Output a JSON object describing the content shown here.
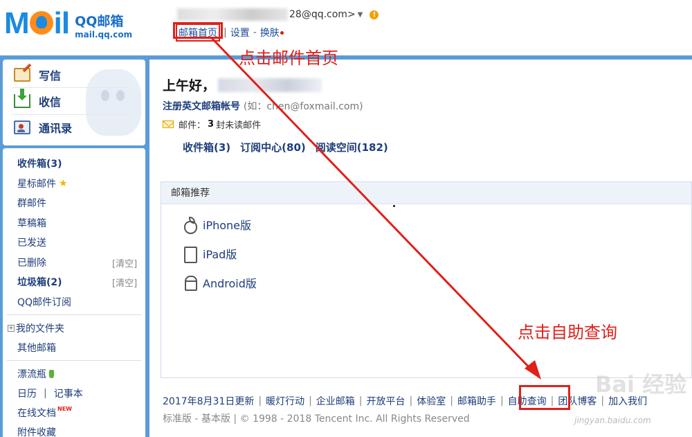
{
  "header": {
    "logo_mark": "M",
    "logo_mark_tail": "il",
    "brand_cn": "QQ邮箱",
    "brand_url": "mail.qq.com",
    "account_suffix": "28@qq.com>",
    "links": [
      "邮箱首页",
      "设置",
      "换肤"
    ],
    "link_dash": "-",
    "link_pipe": "|"
  },
  "sidebar": {
    "actions": [
      {
        "label": "写信",
        "icon": "write-icon"
      },
      {
        "label": "收信",
        "icon": "inbox-download-icon"
      },
      {
        "label": "通讯录",
        "icon": "contacts-icon"
      }
    ],
    "folders": [
      {
        "label": "收件箱(3)",
        "bold": true
      },
      {
        "label": "星标邮件",
        "icon": "star-icon"
      },
      {
        "label": "群邮件"
      },
      {
        "label": "草稿箱"
      },
      {
        "label": "已发送"
      },
      {
        "label": "已删除",
        "action": "[清空]"
      },
      {
        "label": "垃圾箱(2)",
        "bold": true,
        "action": "[清空]"
      },
      {
        "label": "QQ邮件订阅"
      }
    ],
    "my_folders": "我的文件夹",
    "other_mailbox": "其他邮箱",
    "extras": {
      "drift_bottle": "漂流瓶",
      "calendar": "日历",
      "notepad": "记事本",
      "online_docs": "在线文档",
      "new_badge": "NEW",
      "attachments": "附件收藏"
    }
  },
  "main": {
    "greeting": "上午好，",
    "register": "注册英文邮箱帐号",
    "register_hint": "(如：chen@foxmail.com)",
    "unread_prefix": "邮件：",
    "unread_count": "3",
    "unread_suffix": "封未读邮件",
    "quicklinks": [
      "收件箱(3)",
      "订阅中心(80)",
      "阅读空间(182)"
    ],
    "recommend_title": "邮箱推荐",
    "recommend_items": [
      "iPhone版",
      "iPad版",
      "Android版"
    ]
  },
  "footer": {
    "links": [
      "2017年8月31日更新",
      "暖灯行动",
      "企业邮箱",
      "开放平台",
      "体验室",
      "邮箱助手",
      "自助查询",
      "团队博客",
      "加入我们"
    ],
    "version_std": "标准版",
    "version_basic": "基本版",
    "copyright": "© 1998 - 2018 Tencent Inc. All Rights Reserved"
  },
  "annotations": {
    "top_note": "点击邮件首页",
    "bottom_note": "点击自助查询",
    "color": "#e0201a"
  },
  "watermark": {
    "text": "Bai 经验",
    "url": "jingyan.baidu.com"
  },
  "colors": {
    "frame_blue": "#5b9cd8",
    "link_blue": "#1d3d7a",
    "logo_blue": "#1a8be0",
    "logo_orange": "#ff8c1a"
  }
}
